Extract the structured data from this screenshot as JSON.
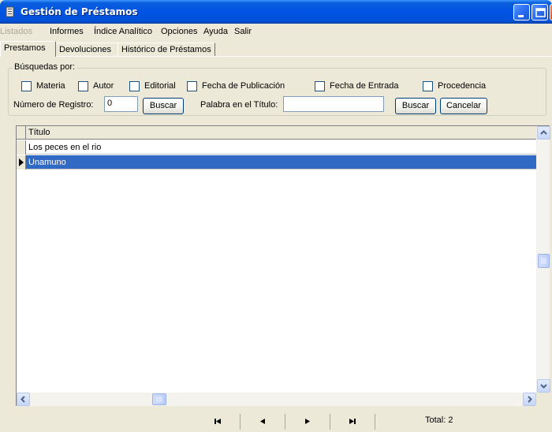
{
  "window": {
    "title": "Gestión de Préstamos"
  },
  "menu": {
    "items": [
      {
        "label": "Listados",
        "enabled": false
      },
      {
        "label": "Informes",
        "enabled": true
      },
      {
        "label": "Índice Analítico",
        "enabled": true
      },
      {
        "label": "Opciones",
        "enabled": true
      },
      {
        "label": "Ayuda",
        "enabled": true
      },
      {
        "label": "Salir",
        "enabled": true
      }
    ]
  },
  "tabs": [
    {
      "label": "Prestamos",
      "active": true
    },
    {
      "label": "Devoluciones",
      "active": false
    },
    {
      "label": "Histórico de Préstamos",
      "active": false
    }
  ],
  "search": {
    "group_label": "Búsquedas por:",
    "checkboxes": [
      {
        "label": "Materia",
        "checked": false
      },
      {
        "label": "Autor",
        "checked": false
      },
      {
        "label": "Editorial",
        "checked": false
      },
      {
        "label": "Fecha de Publicación",
        "checked": false
      },
      {
        "label": "Fecha de Entrada",
        "checked": false
      },
      {
        "label": "Procedencia",
        "checked": false
      }
    ],
    "registro_label": "Número de Registro:",
    "registro_value": "0",
    "buscar_label": "Buscar",
    "titulo_label": "Palabra en el Título:",
    "titulo_value": "",
    "buscar2_label": "Buscar",
    "cancelar_label": "Cancelar"
  },
  "grid": {
    "column_header": "Título",
    "rows": [
      {
        "title": "Los peces en el rio",
        "selected": false
      },
      {
        "title": "Unamuno",
        "selected": true
      }
    ]
  },
  "navigator": {
    "first": "first-record-icon",
    "prev": "prev-record-icon",
    "next": "next-record-icon",
    "last": "last-record-icon",
    "total_label": "Total: 2"
  },
  "colors": {
    "titlebar": "#0054e3",
    "selection": "#316ac5",
    "face": "#ece9d8"
  }
}
